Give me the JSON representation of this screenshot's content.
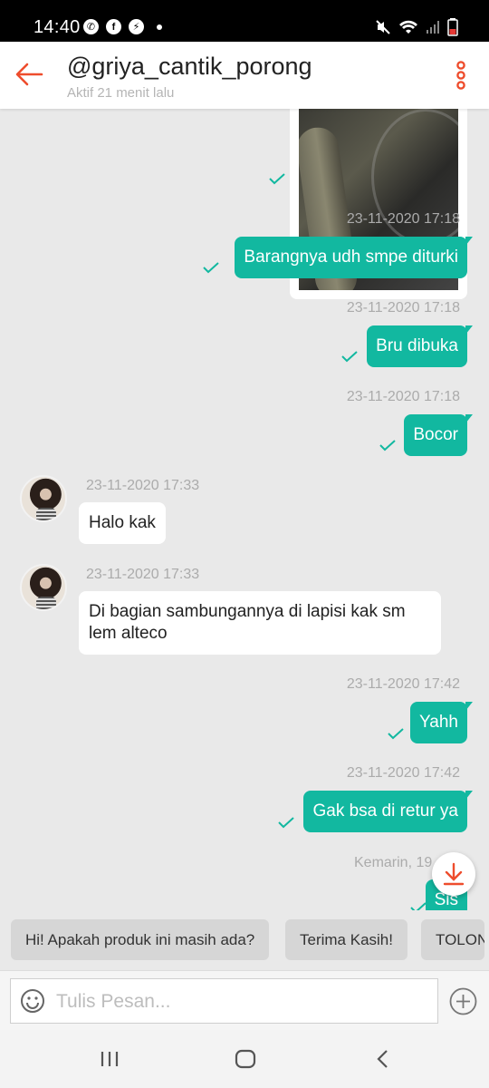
{
  "status_bar": {
    "time": "14:40"
  },
  "header": {
    "title": "@griya_cantik_porong",
    "subtitle": "Aktif 21 menit lalu"
  },
  "messages": [
    {
      "time": "23-11-2020 17:18",
      "text": "Barangnya udh smpe diturki",
      "from": "me"
    },
    {
      "time": "23-11-2020 17:18",
      "text": "Bru dibuka",
      "from": "me"
    },
    {
      "time": "23-11-2020 17:18",
      "text": "Bocor",
      "from": "me"
    },
    {
      "time": "23-11-2020 17:33",
      "text": "Halo kak",
      "from": "seller"
    },
    {
      "time": "23-11-2020 17:33",
      "text": "Di bagian sambungannya di lapisi kak sm lem alteco",
      "from": "seller"
    },
    {
      "time": "23-11-2020 17:42",
      "text": "Yahh",
      "from": "me"
    },
    {
      "time": "23-11-2020 17:42",
      "text": "Gak bsa di retur ya",
      "from": "me"
    },
    {
      "time": "Kemarin, 19",
      "text": "Sis",
      "from": "me"
    }
  ],
  "quick_replies": [
    "Hi! Apakah produk ini masih ada?",
    "Terima Kasih!",
    "TOLONG"
  ],
  "input": {
    "placeholder": "Tulis Pesan..."
  },
  "colors": {
    "accent": "#ee4d2d",
    "bubble_out": "#12b8a0",
    "tick": "#12b8a0"
  }
}
